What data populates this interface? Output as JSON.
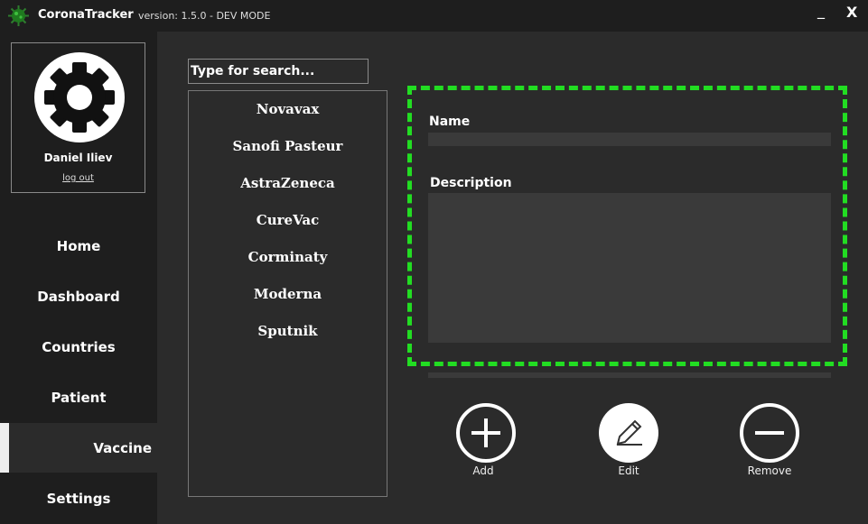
{
  "titlebar": {
    "app_title": "CoronaTracker",
    "version": "version: 1.5.0 - DEV MODE",
    "minimize_label": "_",
    "close_label": "X"
  },
  "user": {
    "name": "Daniel Iliev",
    "logout_label": "log out"
  },
  "nav": {
    "items": [
      {
        "label": "Home"
      },
      {
        "label": "Dashboard"
      },
      {
        "label": "Countries"
      },
      {
        "label": "Patient"
      },
      {
        "label": "Vaccine",
        "active": true
      },
      {
        "label": "Settings"
      }
    ]
  },
  "search": {
    "placeholder": "Type for search..."
  },
  "vaccines": [
    "Novavax",
    "Sanofi Pasteur",
    "AstraZeneca",
    "CureVac",
    "Corminaty",
    "Moderna",
    "Sputnik"
  ],
  "form": {
    "name_label": "Name",
    "name_value": "",
    "description_label": "Description",
    "description_value": ""
  },
  "actions": {
    "add_label": "Add",
    "edit_label": "Edit",
    "remove_label": "Remove"
  },
  "colors": {
    "highlight": "#22dd22",
    "sidebar_bg": "#1e1e1e",
    "content_bg": "#2b2b2b",
    "field_bg": "#3a3a3a"
  },
  "icons": {
    "logo": "virus-icon",
    "avatar": "gear-icon",
    "add": "plus-circle-icon",
    "edit": "pencil-icon",
    "remove": "minus-circle-icon"
  }
}
